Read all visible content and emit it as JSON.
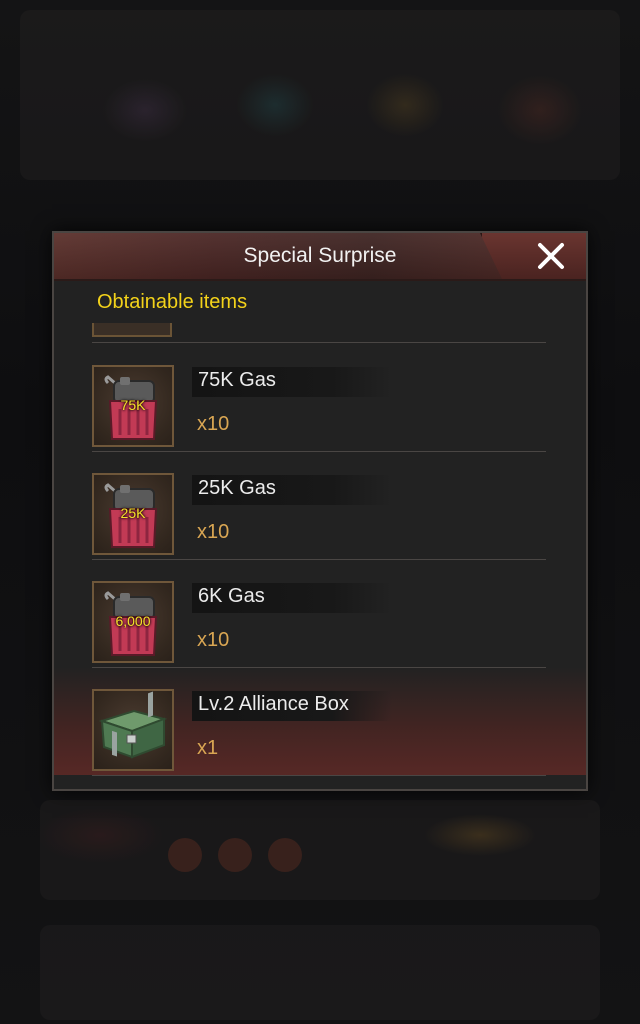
{
  "modal": {
    "title": "Special Surprise",
    "subtitle": "Obtainable items",
    "close_icon": "close-x-icon"
  },
  "items": [
    {
      "name": "75K Gas",
      "quantity": "x10",
      "icon": "gas-canister-icon",
      "badge": "75K"
    },
    {
      "name": "25K Gas",
      "quantity": "x10",
      "icon": "gas-canister-icon",
      "badge": "25K"
    },
    {
      "name": "6K Gas",
      "quantity": "x10",
      "icon": "gas-canister-icon",
      "badge": "6,000"
    },
    {
      "name": "Lv.2 Alliance Box",
      "quantity": "x1",
      "icon": "alliance-box-icon",
      "badge": ""
    }
  ],
  "colors": {
    "title_text": "#f2f2f2",
    "subtitle_text": "#f3d21a",
    "quantity_text": "#d9a653",
    "header_red": "#5a2f2a"
  }
}
